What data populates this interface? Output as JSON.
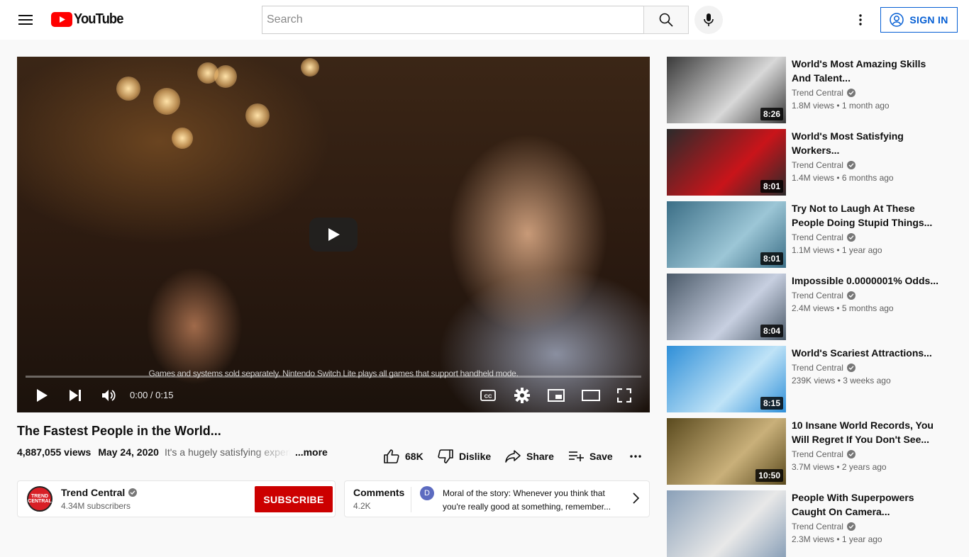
{
  "header": {
    "search_placeholder": "Search",
    "signin_label": "SIGN IN",
    "logo_text": "YouTube"
  },
  "player": {
    "caption": "Games and systems sold separately. Nintendo Switch Lite plays all games that support handheld mode.",
    "time": "0:00 / 0:15"
  },
  "video": {
    "title": "The Fastest People in the World...",
    "views": "4,887,055 views",
    "date": "May 24, 2020",
    "description": "It's a hugely satisfying experience",
    "more_label": "...more",
    "likes": "68K",
    "dislike_label": "Dislike",
    "share_label": "Share",
    "save_label": "Save"
  },
  "channel": {
    "name": "Trend Central",
    "subscribers": "4.34M subscribers",
    "subscribe_label": "SUBSCRIBE",
    "avatar_text": "TREND CENTRAL"
  },
  "comments": {
    "title": "Comments",
    "count": "4.2K",
    "avatar_letter": "D",
    "top_comment": "Moral of the story: Whenever you think that you're really good at something, remember..."
  },
  "recommendations": [
    {
      "title": "World's Most Amazing Skills And Talent...",
      "channel": "Trend Central",
      "meta": "1.8M views • 1 month ago",
      "duration": "8:26",
      "color_a": "#3a3a3a",
      "color_b": "#d8d8d8"
    },
    {
      "title": "World's Most Satisfying Workers...",
      "channel": "Trend Central",
      "meta": "1.4M views • 6 months ago",
      "duration": "8:01",
      "color_a": "#2b2b2b",
      "color_b": "#c9141a"
    },
    {
      "title": "Try Not to Laugh At These People Doing Stupid Things...",
      "channel": "Trend Central",
      "meta": "1.1M views • 1 year ago",
      "duration": "8:01",
      "color_a": "#3b6e86",
      "color_b": "#9cc6d6"
    },
    {
      "title": "Impossible 0.0000001% Odds...",
      "channel": "Trend Central",
      "meta": "2.4M views • 5 months ago",
      "duration": "8:04",
      "color_a": "#4a5968",
      "color_b": "#c7cfe0"
    },
    {
      "title": "World's Scariest Attractions...",
      "channel": "Trend Central",
      "meta": "239K views • 3 weeks ago",
      "duration": "8:15",
      "color_a": "#2f8fd8",
      "color_b": "#bfe3f7"
    },
    {
      "title": "10 Insane World Records, You Will Regret If You Don't See...",
      "channel": "Trend Central",
      "meta": "3.7M views • 2 years ago",
      "duration": "10:50",
      "color_a": "#5a4a1e",
      "color_b": "#c9b07a"
    },
    {
      "title": "People With Superpowers Caught On Camera...",
      "channel": "Trend Central",
      "meta": "2.3M views • 1 year ago",
      "duration": "",
      "color_a": "#8aa0b8",
      "color_b": "#e8e8e8"
    }
  ],
  "colors": {
    "brand_red": "#ff0000",
    "subscribe_red": "#cc0000",
    "link_blue": "#065fd4"
  }
}
